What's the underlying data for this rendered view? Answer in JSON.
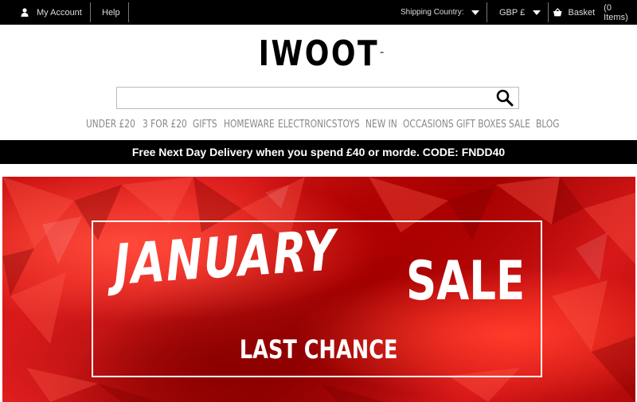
{
  "topbar": {
    "account_label": "My Account",
    "help_label": "Help",
    "shipping_label": "Shipping Country:",
    "currency_label": "GBP £",
    "basket_label": "Basket",
    "basket_count": "(0 Items)"
  },
  "logo": {
    "text": "IWOOT",
    "tm": "™"
  },
  "search": {
    "placeholder": ""
  },
  "nav": {
    "items": [
      "UNDER £20",
      "3 FOR £20",
      "GIFTS",
      "HOMEWARE",
      "ELECTRONICS",
      "TOYS",
      "NEW IN",
      "OCCASIONS",
      "GIFT BOXES",
      "SALE",
      "BLOG"
    ]
  },
  "promo": {
    "text": "Free Next Day Delivery when you spend £40 or morde. CODE: FNDD40"
  },
  "banner": {
    "headline": "JANUARY",
    "headline2": "SALE",
    "subline": "LAST CHANCE"
  },
  "colors": {
    "topbar_bg": "#000000",
    "banner_red": "#d81818",
    "nav_text": "#888888"
  }
}
